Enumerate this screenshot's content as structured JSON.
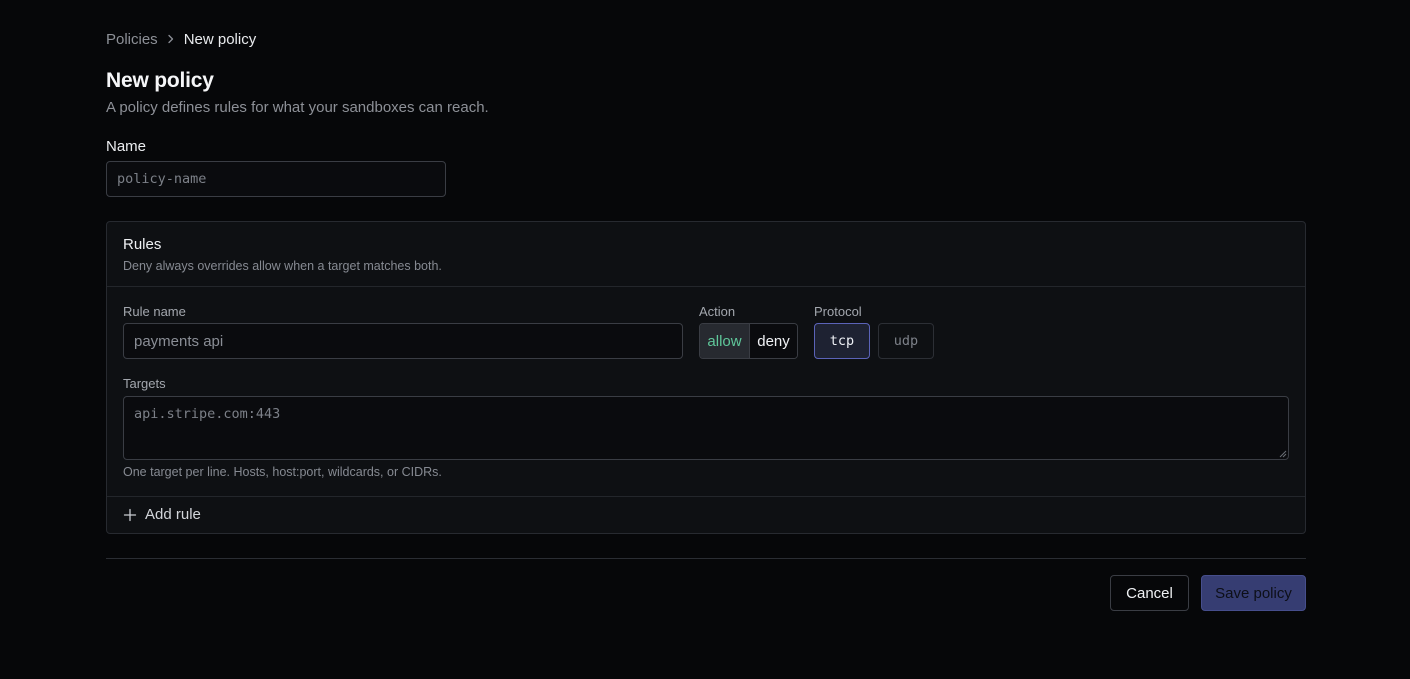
{
  "breadcrumb": {
    "parent": "Policies",
    "current": "New policy"
  },
  "header": {
    "title": "New policy",
    "subtitle": "A policy defines rules for what your sandboxes can reach."
  },
  "name_field": {
    "label": "Name",
    "value": "",
    "placeholder": "policy-name"
  },
  "rules": {
    "title": "Rules",
    "description": "Deny always overrides allow when a target matches both.",
    "rule": {
      "rule_name_label": "Rule name",
      "rule_name_value": "",
      "rule_name_placeholder": "payments api",
      "action_label": "Action",
      "action_options": [
        "allow",
        "deny"
      ],
      "action_selected": "allow",
      "protocol_label": "Protocol",
      "protocol_options": [
        "tcp",
        "udp"
      ],
      "protocol_selected": "tcp",
      "targets_label": "Targets",
      "targets_value": "",
      "targets_placeholder": "api.stripe.com:443",
      "targets_help": "One target per line. Hosts, host:port, wildcards, or CIDRs."
    },
    "add_rule_label": "Add rule"
  },
  "footer": {
    "cancel_label": "Cancel",
    "save_label": "Save policy"
  },
  "colors": {
    "background": "#060709",
    "card": "#0e1013",
    "allow_text": "#5fc79a",
    "accent_border": "#5b63b8",
    "save_button": "#363d72"
  },
  "icons": {
    "breadcrumb_separator": "chevron-right-icon",
    "add_rule": "plus-icon"
  }
}
